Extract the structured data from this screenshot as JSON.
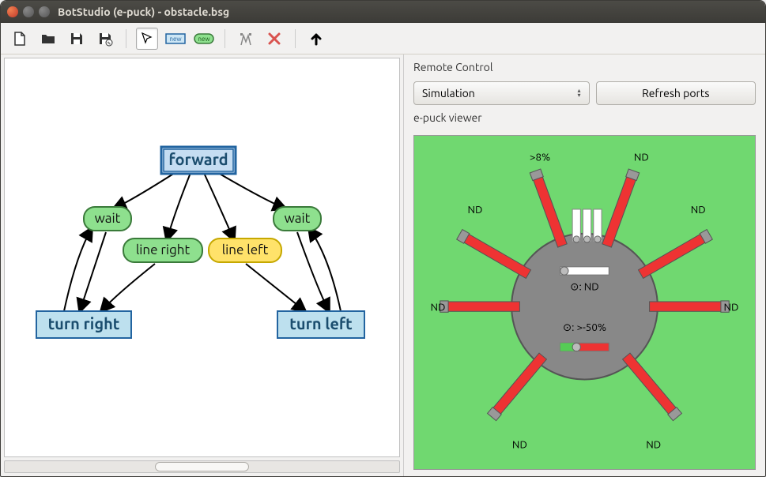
{
  "window": {
    "title": "BotStudio (e-puck) - obstacle.bsg"
  },
  "toolbar": {
    "new_state_badge": "new",
    "new_trans_badge": "new"
  },
  "remote": {
    "label": "Remote Control",
    "mode": "Simulation",
    "refresh": "Refresh ports"
  },
  "viewer": {
    "label": "e-puck viewer",
    "sensors": {
      "top_left_far": "ND",
      "top_left": ">8%",
      "top_right": "ND",
      "top_right_far": "ND",
      "left": "ND",
      "right": "ND",
      "bottom_left": "ND",
      "bottom_right": "ND"
    },
    "center_top": ": ND",
    "center_bottom": ": >-50%"
  },
  "graph": {
    "states": {
      "forward": "forward",
      "turn_right": "turn right",
      "turn_left": "turn left"
    },
    "transitions": {
      "wait_left": "wait",
      "wait_right": "wait",
      "line_right": "line right",
      "line_left": "line left"
    }
  }
}
